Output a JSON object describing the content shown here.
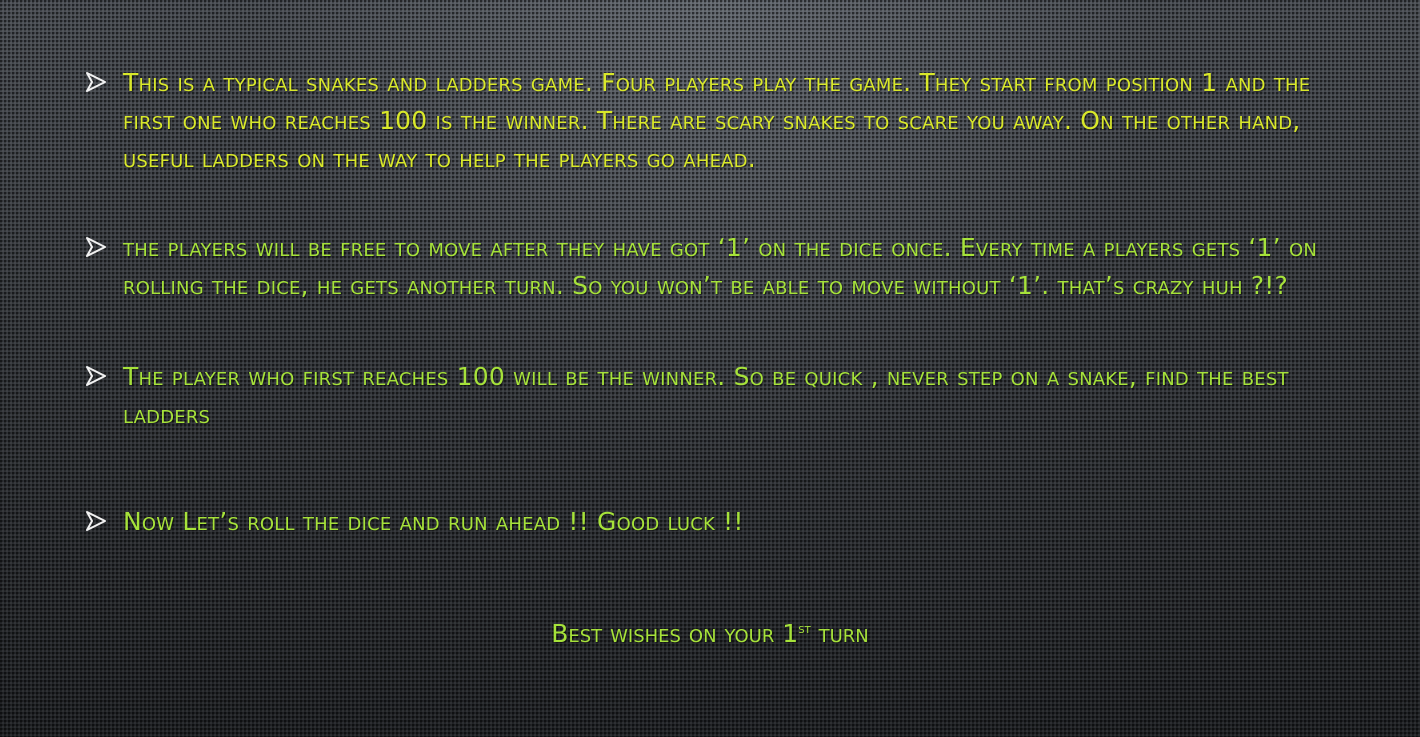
{
  "colors": {
    "text_primary": "#d9e82a",
    "text_secondary": "#a6e23a",
    "bullet_arrow": "#f2f2f2",
    "background": "#34373b"
  },
  "bullets": [
    {
      "icon": "arrow-bullet-icon",
      "text": "This is a typical snakes and ladders game. Four players play the game. They start from position 1 and the first one who reaches 100 is the winner. There are scary snakes to scare you away. On the other hand,  useful ladders on the way to help the players go ahead."
    },
    {
      "icon": "arrow-bullet-icon",
      "text": "the players will be free to move after they have got ‘1’ on the dice once. Every time a players gets ‘1’ on rolling the dice, he gets another turn. So you won’t be able to move without ‘1’. that’s crazy huh ?!?"
    },
    {
      "icon": "arrow-bullet-icon",
      "text": "The player who first reaches 100 will be the winner. So be quick , never step on a snake, find the best ladders"
    },
    {
      "icon": "arrow-bullet-icon",
      "text": "Now Let’s roll the dice and run ahead !! Good luck !!"
    }
  ],
  "closing": {
    "before": "Best wishes on your 1",
    "superscript": "st",
    "after": " turn"
  }
}
